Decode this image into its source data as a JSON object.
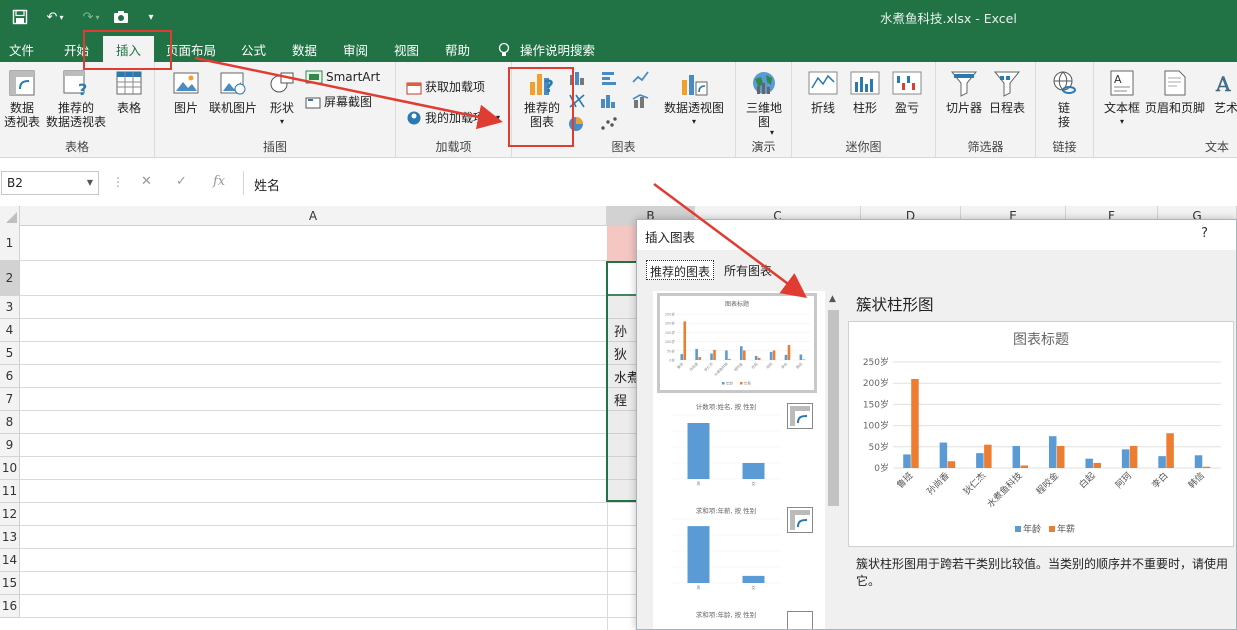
{
  "window": {
    "title": "水煮鱼科技.xlsx  -  Excel"
  },
  "quick_access": {
    "save_icon": "save-icon",
    "undo_icon": "undo-icon",
    "redo_icon": "redo-icon",
    "camera_icon": "camera-icon",
    "customize_icon": "customize-icon"
  },
  "menu": {
    "tabs": [
      "文件",
      "开始",
      "插入",
      "页面布局",
      "公式",
      "数据",
      "审阅",
      "视图",
      "帮助"
    ],
    "active_tab": "插入",
    "tell_me": "操作说明搜索"
  },
  "ribbon": {
    "tables": {
      "name": "表格",
      "pivot": "数据\n透视表",
      "recommended_pivot": "推荐的\n数据透视表",
      "table": "表格"
    },
    "illustrations": {
      "name": "插图",
      "picture": "图片",
      "online_picture": "联机图片",
      "shapes": "形状",
      "smartart": "SmartArt",
      "screenshot": "屏幕截图"
    },
    "addins": {
      "name": "加载项",
      "get_addins": "获取加载项",
      "my_addins": "我的加载项"
    },
    "charts": {
      "name": "图表",
      "recommended": "推荐的\n图表",
      "pivot_chart": "数据透视图"
    },
    "tours": {
      "name": "演示",
      "map3d": "三维地\n图"
    },
    "sparklines": {
      "name": "迷你图",
      "line": "折线",
      "column": "柱形",
      "winloss": "盈亏"
    },
    "filters": {
      "name": "筛选器",
      "slicer": "切片器",
      "timeline": "日程表"
    },
    "links": {
      "name": "链接",
      "link": "链\n接"
    },
    "text": {
      "name": "文本",
      "textbox": "文本框",
      "header_footer": "页眉和页脚",
      "wordart": "艺术"
    }
  },
  "formula_bar": {
    "name_box": "B2",
    "formula": "姓名"
  },
  "sheet": {
    "columns": [
      "A",
      "B",
      "C",
      "D",
      "E",
      "F",
      "G"
    ],
    "rows": [
      "1",
      "2",
      "3",
      "4",
      "5",
      "6",
      "7",
      "8",
      "9",
      "10",
      "11",
      "12",
      "13",
      "14",
      "15",
      "16"
    ],
    "visible_b_cells": [
      {
        "row": "4",
        "text": "孙"
      },
      {
        "row": "5",
        "text": "狄"
      },
      {
        "row": "6",
        "text": "水煮"
      },
      {
        "row": "7",
        "text": "程"
      }
    ]
  },
  "dialog": {
    "title": "插入图表",
    "help": "?",
    "tabs": [
      "推荐的图表",
      "所有图表"
    ],
    "selected_type": "簇状柱形图",
    "description": "簇状柱形图用于跨若干类别比较值。当类别的顺序并不重要时，请使用它。",
    "thumbnails": [
      {
        "title": "图表标题"
      },
      {
        "title": "计数项:姓名, 按 性别"
      },
      {
        "title": "求和项:年薪, 按 性别"
      },
      {
        "title": "求和项:年龄, 按 性别"
      }
    ]
  },
  "chart_data": {
    "type": "bar",
    "title": "图表标题",
    "categories": [
      "鲁班",
      "孙尚香",
      "狄仁杰",
      "水煮鱼科技",
      "程咬金",
      "白起",
      "阿珂",
      "李白",
      "韩信"
    ],
    "series": [
      {
        "name": "年龄",
        "color": "#5b9bd5",
        "values": [
          32,
          60,
          35,
          52,
          75,
          22,
          44,
          28,
          30
        ]
      },
      {
        "name": "年薪",
        "color": "#ed7d31",
        "values": [
          210,
          16,
          55,
          6,
          52,
          12,
          52,
          82,
          3
        ]
      }
    ],
    "yticks": [
      "0岁",
      "50岁",
      "100岁",
      "150岁",
      "200岁",
      "250岁"
    ],
    "ylim": [
      0,
      250
    ],
    "legend": "bottom",
    "grid": true
  },
  "thumb_charts": [
    {
      "categories": [
        "男",
        "女"
      ],
      "values": [
        7,
        2
      ],
      "ymax": 8
    },
    {
      "categories": [
        "男",
        "女"
      ],
      "values": [
        400,
        50
      ],
      "ymax": 450
    }
  ],
  "colors": {
    "excel_green": "#217346",
    "highlight_red": "#e03c31",
    "header_pink": "#f4c7c3"
  }
}
